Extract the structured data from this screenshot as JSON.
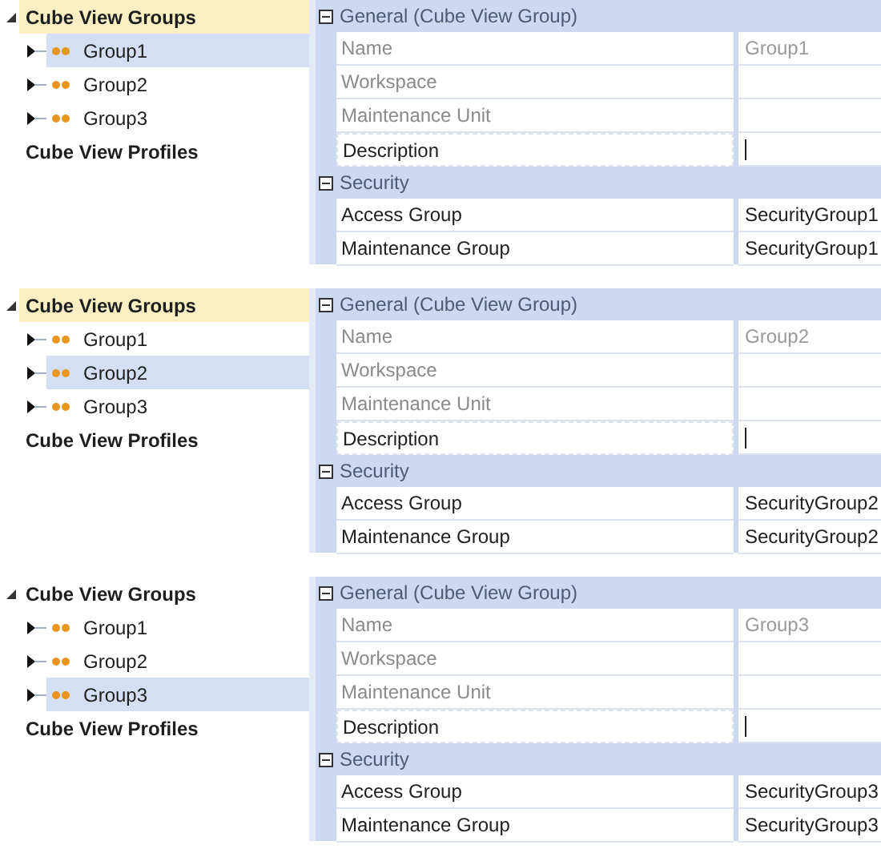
{
  "panels": [
    {
      "tree": [
        {
          "label": "Cube View Groups",
          "expanded": true,
          "highlighted": true,
          "children": [
            {
              "label": "Group1",
              "selected": true
            },
            {
              "label": "Group2",
              "selected": false
            },
            {
              "label": "Group3",
              "selected": false
            }
          ]
        },
        {
          "label": "Cube View Profiles",
          "expanded": false,
          "highlighted": false
        }
      ],
      "grid": [
        {
          "title": "General (Cube View Group)",
          "expanded": true,
          "rows": [
            {
              "name": "Name",
              "value": "Group1",
              "disabled": true,
              "focused": false,
              "editing": false
            },
            {
              "name": "Workspace",
              "disabled": true,
              "focused": false,
              "editing": false
            },
            {
              "name": "Maintenance Unit",
              "disabled": true,
              "focused": false,
              "editing": false
            },
            {
              "name": "Description",
              "disabled": false,
              "focused": true,
              "editing": true
            }
          ]
        },
        {
          "title": "Security",
          "expanded": true,
          "rows": [
            {
              "name": "Access Group",
              "value": "SecurityGroup1",
              "disabled": false,
              "focused": false,
              "editing": false
            },
            {
              "name": "Maintenance Group",
              "value": "SecurityGroup1",
              "disabled": false,
              "focused": false,
              "editing": false
            }
          ]
        }
      ]
    },
    {
      "tree": [
        {
          "label": "Cube View Groups",
          "expanded": true,
          "highlighted": true,
          "children": [
            {
              "label": "Group1",
              "selected": false
            },
            {
              "label": "Group2",
              "selected": true
            },
            {
              "label": "Group3",
              "selected": false
            }
          ]
        },
        {
          "label": "Cube View Profiles",
          "expanded": false,
          "highlighted": false
        }
      ],
      "grid": [
        {
          "title": "General (Cube View Group)",
          "expanded": true,
          "rows": [
            {
              "name": "Name",
              "value": "Group2",
              "disabled": true,
              "focused": false,
              "editing": false
            },
            {
              "name": "Workspace",
              "disabled": true,
              "focused": false,
              "editing": false
            },
            {
              "name": "Maintenance Unit",
              "disabled": true,
              "focused": false,
              "editing": false
            },
            {
              "name": "Description",
              "disabled": false,
              "focused": true,
              "editing": true
            }
          ]
        },
        {
          "title": "Security",
          "expanded": true,
          "rows": [
            {
              "name": "Access Group",
              "value": "SecurityGroup2",
              "disabled": false,
              "focused": false,
              "editing": false
            },
            {
              "name": "Maintenance Group",
              "value": "SecurityGroup2",
              "disabled": false,
              "focused": false,
              "editing": false
            }
          ]
        }
      ]
    },
    {
      "tree": [
        {
          "label": "Cube View Groups",
          "expanded": true,
          "highlighted": false,
          "children": [
            {
              "label": "Group1",
              "selected": false
            },
            {
              "label": "Group2",
              "selected": false
            },
            {
              "label": "Group3",
              "selected": true
            }
          ]
        },
        {
          "label": "Cube View Profiles",
          "expanded": false,
          "highlighted": false
        }
      ],
      "grid": [
        {
          "title": "General (Cube View Group)",
          "expanded": true,
          "rows": [
            {
              "name": "Name",
              "value": "Group3",
              "disabled": true,
              "focused": false,
              "editing": false
            },
            {
              "name": "Workspace",
              "disabled": true,
              "focused": false,
              "editing": false
            },
            {
              "name": "Maintenance Unit",
              "disabled": true,
              "focused": false,
              "editing": false
            },
            {
              "name": "Description",
              "disabled": false,
              "focused": true,
              "editing": true
            }
          ]
        },
        {
          "title": "Security",
          "expanded": true,
          "rows": [
            {
              "name": "Access Group",
              "value": "SecurityGroup3",
              "disabled": false,
              "focused": false,
              "editing": false
            },
            {
              "name": "Maintenance Group",
              "value": "SecurityGroup3",
              "disabled": false,
              "focused": false,
              "editing": false
            }
          ]
        }
      ]
    }
  ]
}
